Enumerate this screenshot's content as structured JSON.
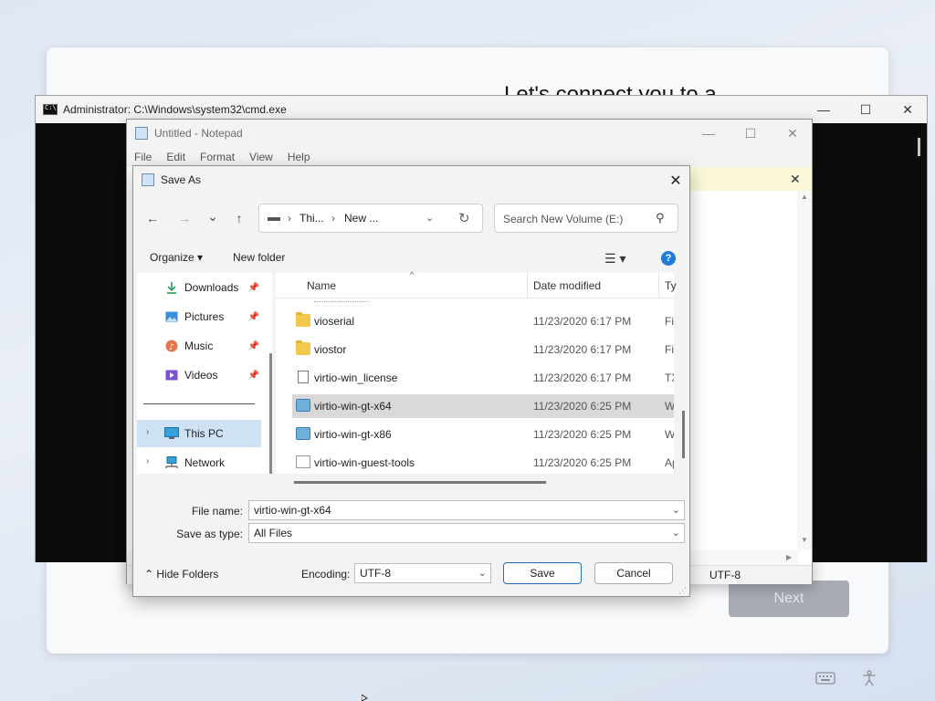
{
  "oobe": {
    "heading": "Let's connect you to a",
    "next_label": "Next"
  },
  "cmd": {
    "title": "Administrator: C:\\Windows\\system32\\cmd.exe",
    "minimize": "—",
    "maximize": "☐",
    "close": "✕"
  },
  "notepad": {
    "title": "Untitled - Notepad",
    "menu": [
      "File",
      "Edit",
      "Format",
      "View",
      "Help"
    ],
    "minimize": "—",
    "maximize": "☐",
    "close": "✕",
    "notice_close": "✕",
    "status_encoding": "UTF-8"
  },
  "dialog": {
    "title": "Save As",
    "close": "✕",
    "nav": {
      "back": "←",
      "forward": "→",
      "recent": "⌄",
      "up": "↑"
    },
    "address": {
      "crumbs": [
        "Thi...",
        "New ..."
      ],
      "separator": "›",
      "dropdown": "⌄",
      "refresh": "↻"
    },
    "search": {
      "placeholder": "Search New Volume (E:)",
      "icon": "⚲"
    },
    "commandbar": {
      "organize": "Organize ▾",
      "new_folder": "New folder",
      "view_icon": "☰ ▾",
      "help_icon": "?"
    },
    "navpane": {
      "items": [
        {
          "label": "Downloads",
          "icon": "downloads-icon",
          "pinned": true
        },
        {
          "label": "Pictures",
          "icon": "pictures-icon",
          "pinned": true
        },
        {
          "label": "Music",
          "icon": "music-icon",
          "pinned": true
        },
        {
          "label": "Videos",
          "icon": "videos-icon",
          "pinned": true
        },
        {
          "label": "This PC",
          "icon": "pc-icon",
          "selected": true
        },
        {
          "label": "Network",
          "icon": "network-icon"
        }
      ],
      "pin_glyph": "📌",
      "expand_glyph": "›"
    },
    "filelist": {
      "columns": {
        "name": "Name",
        "date": "Date modified",
        "type": "Ty"
      },
      "sort_glyph": "^",
      "rows": [
        {
          "name": "vioserial",
          "date": "11/23/2020 6:17 PM",
          "type": "Fi",
          "kind": "folder"
        },
        {
          "name": "viostor",
          "date": "11/23/2020 6:17 PM",
          "type": "Fi",
          "kind": "folder"
        },
        {
          "name": "virtio-win_license",
          "date": "11/23/2020 6:17 PM",
          "type": "TX",
          "kind": "text"
        },
        {
          "name": "virtio-win-gt-x64",
          "date": "11/23/2020 6:25 PM",
          "type": "W",
          "kind": "msi",
          "selected": true
        },
        {
          "name": "virtio-win-gt-x86",
          "date": "11/23/2020 6:25 PM",
          "type": "W",
          "kind": "msi"
        },
        {
          "name": "virtio-win-guest-tools",
          "date": "11/23/2020 6:25 PM",
          "type": "Ap",
          "kind": "app"
        }
      ]
    },
    "filename": {
      "label": "File name:",
      "value": "virtio-win-gt-x64"
    },
    "savetype": {
      "label": "Save as type:",
      "value": "All Files"
    },
    "hide_folders": "⌃  Hide Folders",
    "encoding": {
      "label": "Encoding:",
      "value": "UTF-8"
    },
    "save_label": "Save",
    "cancel_label": "Cancel",
    "combo_arrow": "⌄"
  }
}
